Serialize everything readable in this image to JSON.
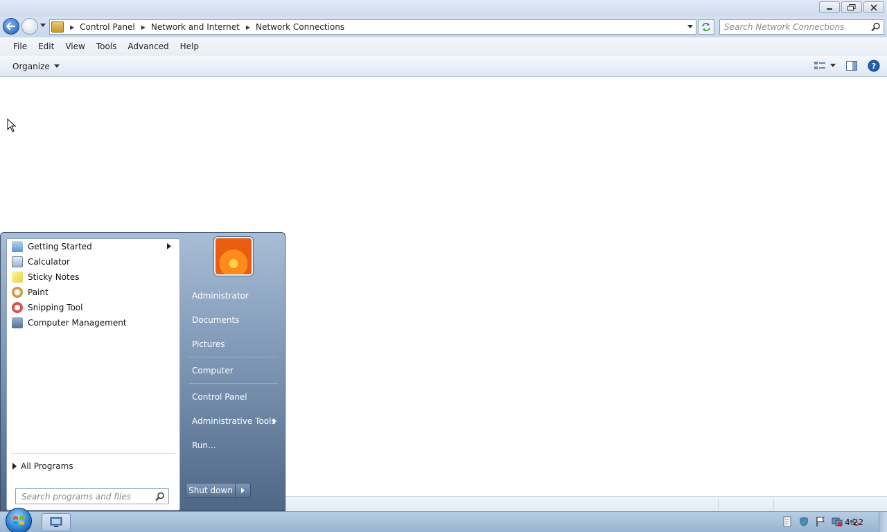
{
  "window": {
    "title": "Network Connections",
    "address": {
      "crumbs": [
        "Control Panel",
        "Network and Internet",
        "Network Connections"
      ]
    },
    "search": {
      "placeholder": "Search Network Connections"
    },
    "menu": {
      "file": "File",
      "edit": "Edit",
      "view": "View",
      "tools": "Tools",
      "advanced": "Advanced",
      "help": "Help"
    },
    "command_bar": {
      "organize": "Organize"
    }
  },
  "start_menu": {
    "programs": [
      {
        "label": "Getting Started",
        "icon": "getting-started-icon",
        "submenu": true
      },
      {
        "label": "Calculator",
        "icon": "calculator-icon"
      },
      {
        "label": "Sticky Notes",
        "icon": "sticky-notes-icon"
      },
      {
        "label": "Paint",
        "icon": "paint-icon"
      },
      {
        "label": "Snipping Tool",
        "icon": "snipping-tool-icon"
      },
      {
        "label": "Computer Management",
        "icon": "computer-management-icon"
      }
    ],
    "all_programs": "All Programs",
    "search_placeholder": "Search programs and files",
    "right_items": {
      "user": "Administrator",
      "documents": "Documents",
      "pictures": "Pictures",
      "computer": "Computer",
      "control_panel": "Control Panel",
      "admin_tools": "Administrative Tools",
      "run": "Run..."
    },
    "shutdown": "Shut down"
  },
  "taskbar": {
    "clock": "4:22"
  },
  "colors": {
    "accent": "#1f5fb8",
    "start_menu_dark": "#4f6786",
    "taskbar": "#99b4d1"
  }
}
